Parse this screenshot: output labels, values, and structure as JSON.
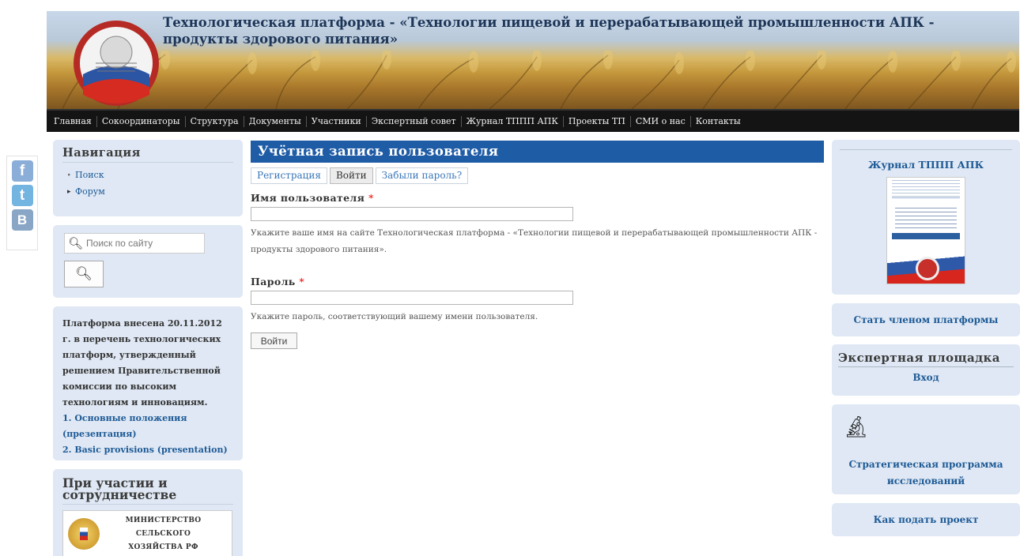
{
  "header": {
    "title": "Технологическая платформа - «Технологии пищевой и перерабатывающей промышленности АПК - продукты здорового питания»"
  },
  "nav": {
    "items": [
      "Главная",
      "Сокоординаторы",
      "Структура",
      "Документы",
      "Участники",
      "Экспертный совет",
      "Журнал ТППП АПК",
      "Проекты ТП",
      "СМИ о нас",
      "Контакты"
    ]
  },
  "social": {
    "facebook": "f",
    "twitter": "t",
    "vk": "B"
  },
  "left": {
    "navigation_title": "Навигация",
    "nav_items": [
      {
        "marker": "∘",
        "label": "Поиск"
      },
      {
        "marker": "▸",
        "label": "Форум"
      }
    ],
    "search_placeholder": "Поиск по сайту",
    "info_text": "Платформа внесена 20.11.2012 г. в перечень технологических платформ, утвержденный решением Правительственной комиссии по высоким технологиям и инновациям.",
    "info_link1": "1. Основные положения (презентация)",
    "info_link2": "2. Basic provisions (presentation)",
    "partner_title": "При участии и сотрудничестве",
    "ministry_line1": "МИНИСТЕРСТВО СЕЛЬСКОГО",
    "ministry_line2": "ХОЗЯЙСТВА РФ"
  },
  "main": {
    "title": "Учётная запись пользователя",
    "tabs": [
      {
        "label": "Регистрация",
        "active": false
      },
      {
        "label": "Войти",
        "active": true
      },
      {
        "label": "Забыли пароль?",
        "active": false
      }
    ],
    "username_label": "Имя пользователя",
    "username_value": "",
    "username_desc": "Укажите ваше имя на сайте Технологическая платформа - «Технологии пищевой и перерабатывающей промышленности АПК - продукты здорового питания».",
    "password_label": "Пароль",
    "password_value": "",
    "password_desc": "Укажите пароль, соответствующий вашему имени пользователя.",
    "required_mark": "*",
    "submit_label": "Войти"
  },
  "right": {
    "journal_title": "Журнал ТППП АПК",
    "member_link": "Стать членом платформы",
    "expert_title": "Экспертная площадка",
    "expert_login": "Вход",
    "strategy_link": "Стратегическая программа исследований",
    "how_link": "Как подать проект"
  },
  "colors": {
    "nav_bg": "#141414",
    "title_bar": "#1f5ca6",
    "block_bg": "#dfe8f4",
    "link": "#1e5a96"
  }
}
